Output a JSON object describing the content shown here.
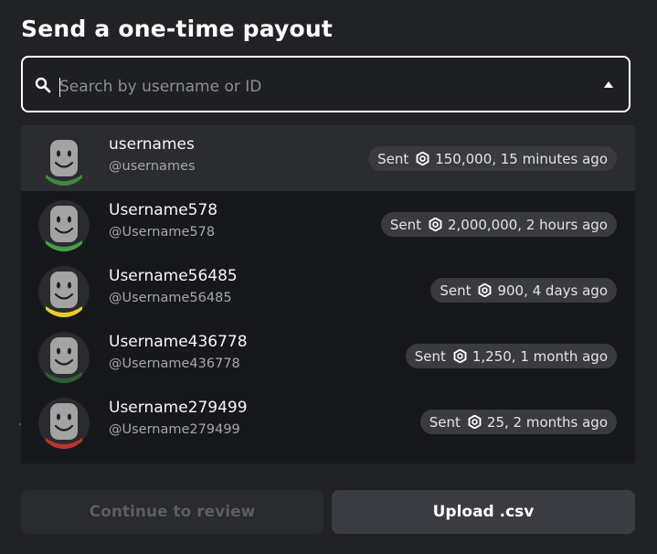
{
  "dialog": {
    "title": "Send a one-time payout"
  },
  "search": {
    "placeholder": "Search by username or ID",
    "value": ""
  },
  "results": [
    {
      "name": "usernames",
      "handle": "@usernames",
      "sent_prefix": "Sent",
      "sent_detail": "150,000, 15 minutes ago",
      "highlighted": true,
      "collar": "#3b8a3e"
    },
    {
      "name": "Username578",
      "handle": "@Username578",
      "sent_prefix": "Sent",
      "sent_detail": "2,000,000, 2 hours ago",
      "highlighted": false,
      "collar": "#46a04a"
    },
    {
      "name": "Username56485",
      "handle": "@Username56485",
      "sent_prefix": "Sent",
      "sent_detail": "900, 4 days ago",
      "highlighted": false,
      "collar": "#e4cf2a"
    },
    {
      "name": "Username436778",
      "handle": "@Username436778",
      "sent_prefix": "Sent",
      "sent_detail": "1,250, 1 month ago",
      "highlighted": false,
      "collar": "#2f5f31"
    },
    {
      "name": "Username279499",
      "handle": "@Username279499",
      "sent_prefix": "Sent",
      "sent_detail": "25, 2 months ago",
      "highlighted": false,
      "collar": "#c0322c"
    }
  ],
  "buttons": {
    "continue_label": "Continue to review",
    "upload_label": "Upload .csv"
  },
  "colors": {
    "background": "#212226",
    "dropdown": "#17181b",
    "highlight_row": "#2b2c30",
    "pill": "#3a3b40"
  },
  "icons": {
    "search": "search-icon",
    "dropdown_arrow": "triangle-up-icon",
    "currency": "robux-icon"
  }
}
